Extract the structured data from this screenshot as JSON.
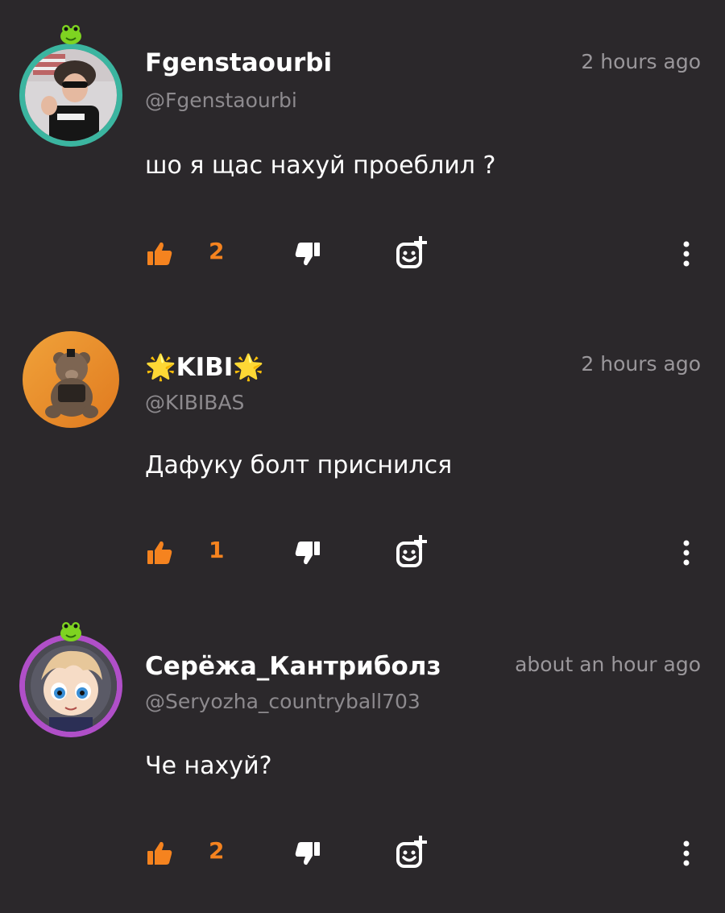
{
  "colors": {
    "background": "#2b282b",
    "accent": "#f5831f",
    "username": "#ffffff",
    "handle": "#8d8a8e",
    "timestamp": "#9a979b"
  },
  "comments": [
    {
      "username": "Fgenstaourbi",
      "handle": "@Fgenstaourbi",
      "time": "2 hours ago",
      "text": "шо я щас нахуй проеблил ?",
      "likes": "2",
      "avatar": "user-photo-avatar",
      "avatar_ring": "#3bb5a0",
      "badge": "frog-badge-icon"
    },
    {
      "username": "🌟KIBI🌟",
      "handle": "@KIBIBAS",
      "time": "2 hours ago",
      "text": "Дафуку болт приснился",
      "likes": "1",
      "avatar": "teddy-bear-avatar"
    },
    {
      "username": "Серёжа_Кантриболз",
      "handle": "@Seryozha_countryball703",
      "time": "about an hour ago",
      "text": "Че нахуй?",
      "likes": "2",
      "avatar": "anime-character-avatar",
      "avatar_ring": "#b04fc8",
      "badge": "frog-badge-icon"
    }
  ],
  "icons": {
    "like": "thumbs-up-icon",
    "dislike": "thumbs-down-icon",
    "react": "add-emoji-icon",
    "more": "more-vertical-icon"
  }
}
